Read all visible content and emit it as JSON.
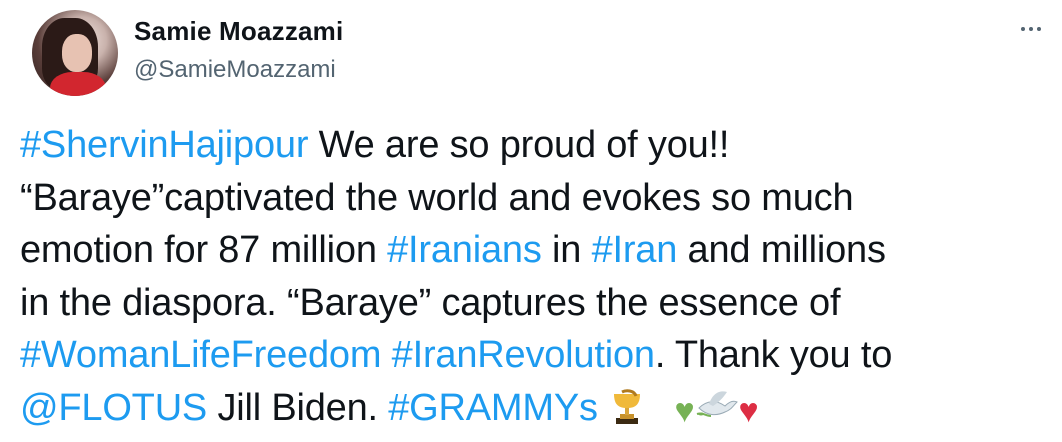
{
  "author": {
    "display_name": "Samie Moazzami",
    "handle": "@SamieMoazzami"
  },
  "tweet": {
    "line1": {
      "t1": "#ShervinHajipour",
      "t2": " We are so proud of you!!"
    },
    "line2": {
      "t1": "“Baraye”captivated the world and evokes so much"
    },
    "line3": {
      "t1": "emotion for 87 million ",
      "t2": "#Iranians",
      "t3": " in ",
      "t4": "#Iran",
      "t5": " and millions"
    },
    "line4": {
      "t1": "in the diaspora. “Baraye” captures the essence of"
    },
    "line5": {
      "t1": "#WomanLifeFreedom",
      "t2": " ",
      "t3": "#IranRevolution",
      "t4": ". Thank you to"
    },
    "line6": {
      "t1": "@FLOTUS",
      "t2": " Jill Biden. ",
      "t3": "#GRAMMYs",
      "t4": " "
    },
    "emojis": {
      "heart_green": "♥",
      "heart_red": "♥"
    }
  },
  "colors": {
    "link": "#1d9bf0",
    "text": "#0f1419",
    "secondary": "#536471"
  },
  "icons": [
    "more-icon",
    "trophy-icon",
    "green-heart-icon",
    "dove-icon",
    "red-heart-icon"
  ]
}
